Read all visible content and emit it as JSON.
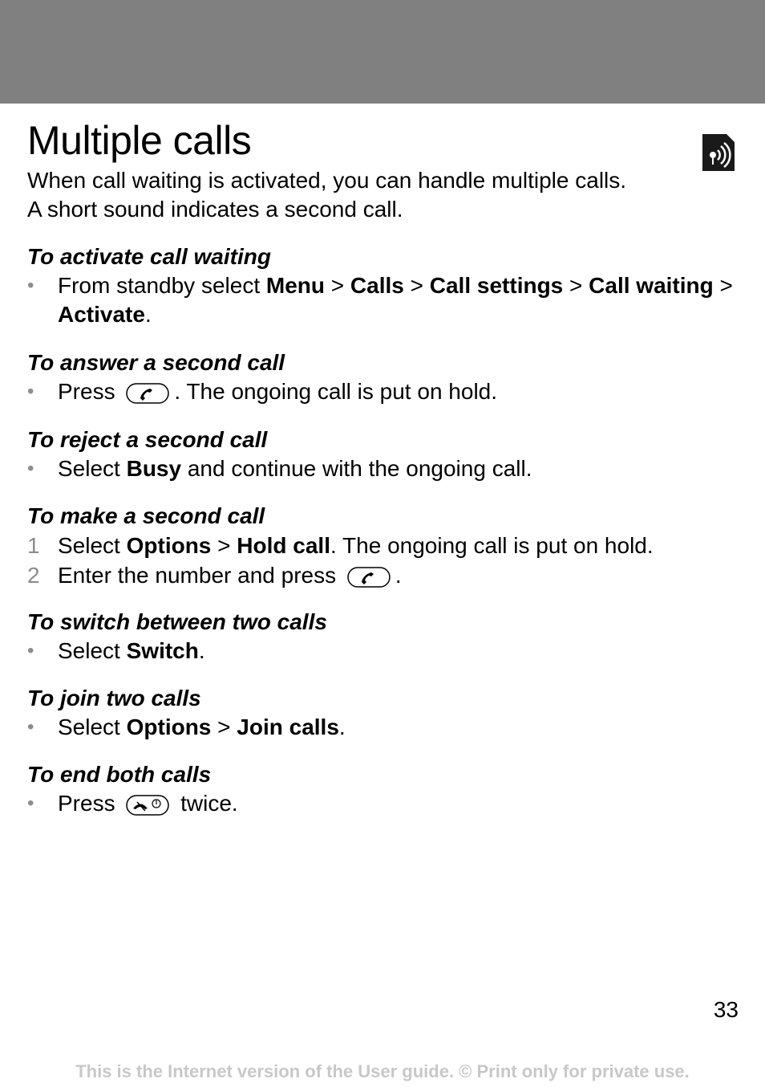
{
  "page": {
    "title": "Multiple calls",
    "intro_line1": "When call waiting is activated, you can handle multiple calls.",
    "intro_line2": "A short sound indicates a second call.",
    "page_number": "33",
    "footer": "This is the Internet version of the User guide. © Print only for private use."
  },
  "sections": [
    {
      "heading": "To activate call waiting",
      "items": [
        {
          "marker": "•",
          "p1": "From standby select ",
          "b1": "Menu",
          "p2": " > ",
          "b2": "Calls",
          "p3": " > ",
          "b3": "Call settings",
          "p4": " > ",
          "b4": "Call waiting",
          "p5": " > ",
          "b5": "Activate",
          "p6": "."
        }
      ]
    },
    {
      "heading": "To answer a second call",
      "items": [
        {
          "marker": "•",
          "p1": "Press ",
          "key": "call-key-icon",
          "p2": ". The ongoing call is put on hold."
        }
      ]
    },
    {
      "heading": "To reject a second call",
      "items": [
        {
          "marker": "•",
          "p1": "Select ",
          "b1": "Busy",
          "p2": " and continue with the ongoing call."
        }
      ]
    },
    {
      "heading": "To make a second call",
      "items": [
        {
          "marker": "1",
          "p1": "Select ",
          "b1": "Options",
          "p2": " > ",
          "b2": "Hold call",
          "p3": ". The ongoing call is put on hold."
        },
        {
          "marker": "2",
          "p1": "Enter the number and press ",
          "key": "call-key-icon",
          "p2": "."
        }
      ]
    },
    {
      "heading": "To switch between two calls",
      "items": [
        {
          "marker": "•",
          "p1": "Select ",
          "b1": "Switch",
          "p2": "."
        }
      ]
    },
    {
      "heading": "To join two calls",
      "items": [
        {
          "marker": "•",
          "p1": "Select ",
          "b1": "Options",
          "p2": " > ",
          "b2": "Join calls",
          "p3": "."
        }
      ]
    },
    {
      "heading": "To end both calls",
      "items": [
        {
          "marker": "•",
          "p1": "Press ",
          "key": "end-call-key-icon",
          "p2": " twice."
        }
      ]
    }
  ],
  "icons": {
    "feature": "network-service-icon"
  }
}
